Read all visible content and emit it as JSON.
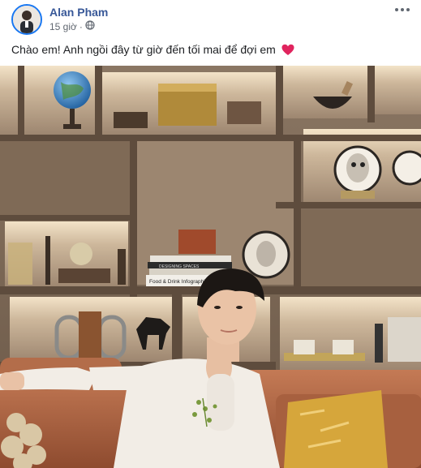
{
  "post": {
    "author": "Alan Pham",
    "time": "15 giờ",
    "privacy_icon": "globe-icon",
    "menu_icon": "more-options-icon",
    "text": "Chào em! Anh ngồi đây từ giờ đến tối mai để đợi em",
    "emoji": "red-heart-icon"
  },
  "photo": {
    "book_spine": "Food & Drink Infographics",
    "book_spine_2": "DESIGNING SPACES"
  },
  "colors": {
    "author_link": "#385898",
    "meta_text": "#606770",
    "avatar_ring": "#1877f2",
    "heart": "#e0245e"
  }
}
